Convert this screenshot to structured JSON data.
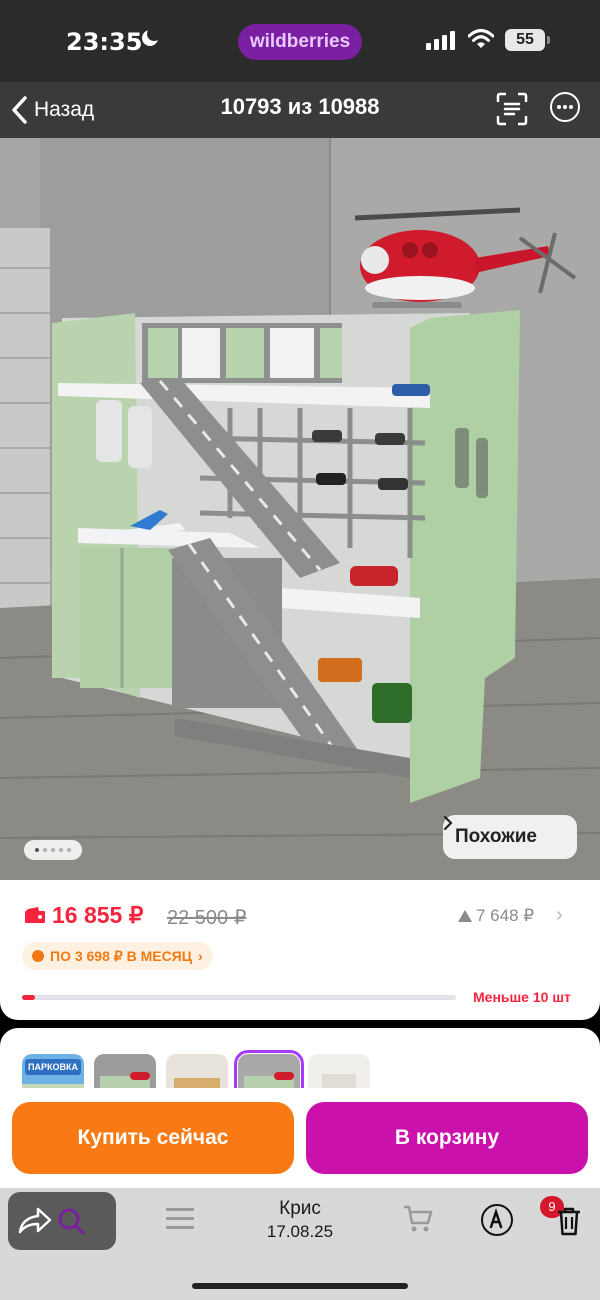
{
  "status_bar": {
    "time": "23:35",
    "brand": "wildberries",
    "battery": "55"
  },
  "nav": {
    "back_label": "Назад",
    "counter": "10793 из 10988"
  },
  "photo": {
    "alt": "",
    "similar_label": "Похожие",
    "gallery_count": 5,
    "gallery_active": 0
  },
  "price": {
    "current": "16 855 ₽",
    "old": "22 500 ₽",
    "delta": "7 648 ₽",
    "installment": "ПО 3 698 ₽ В МЕСЯЦ",
    "stock_label": "Меньше 10 шт",
    "stock_fraction": 0.03
  },
  "thumbs": {
    "banner_text": "ПАРКОВКА",
    "selected_index": 3
  },
  "actions": {
    "buy_now": "Купить сейчас",
    "add_to_cart": "В корзину"
  },
  "bottom": {
    "caption_name": "Крис",
    "caption_date": "17.08.25",
    "badge": "9"
  },
  "colors": {
    "accent": "#cb11ab",
    "buy": "#f97a15",
    "price": "#f6253d"
  }
}
